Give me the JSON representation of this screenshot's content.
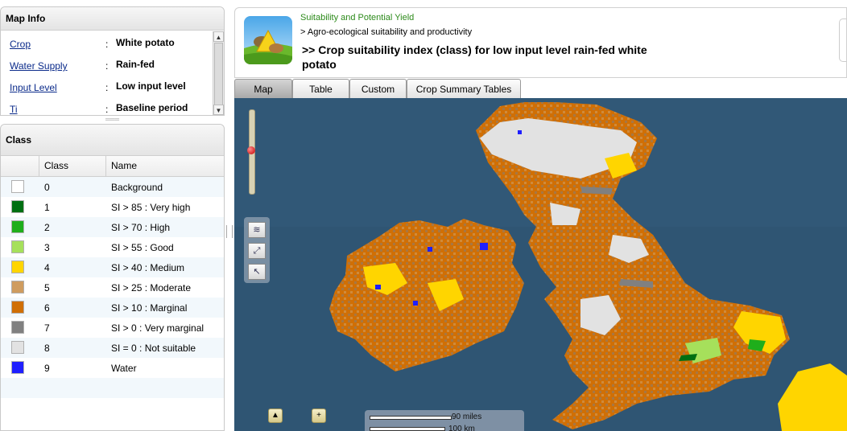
{
  "map_info": {
    "title": "Map Info",
    "rows": [
      {
        "key": "Crop",
        "sep": ":",
        "value": "White potato"
      },
      {
        "key": "Water Supply",
        "sep": ":",
        "value": "Rain-fed"
      },
      {
        "key": "Input Level",
        "sep": ":",
        "value": "Low input level"
      },
      {
        "key": "Ti",
        "sep": ":",
        "value": "Baseline period"
      }
    ]
  },
  "class_panel": {
    "title": "Class",
    "columns": [
      "Class",
      "Name"
    ],
    "rows": [
      {
        "class": "0",
        "name": "Background",
        "color": "#ffffff"
      },
      {
        "class": "1",
        "name": "SI > 85 : Very high",
        "color": "#006f12"
      },
      {
        "class": "2",
        "name": "SI > 70 : High",
        "color": "#1fae1b"
      },
      {
        "class": "3",
        "name": "SI > 55 : Good",
        "color": "#a6e05b"
      },
      {
        "class": "4",
        "name": "SI > 40 : Medium",
        "color": "#ffd500"
      },
      {
        "class": "5",
        "name": "SI > 25 : Moderate",
        "color": "#cf9c5f"
      },
      {
        "class": "6",
        "name": "SI > 10 : Marginal",
        "color": "#d06f05"
      },
      {
        "class": "7",
        "name": "SI >  0 : Very marginal",
        "color": "#808080"
      },
      {
        "class": "8",
        "name": "SI =  0 : Not suitable",
        "color": "#e2e2e2"
      },
      {
        "class": "9",
        "name": "Water",
        "color": "#1f1fff"
      }
    ]
  },
  "header": {
    "crumb1": "Suitability and Potential Yield",
    "crumb2": "> Agro-ecological suitability and productivity",
    "title": ">> Crop suitability index (class) for low input level rain-fed white potato"
  },
  "tabs": [
    {
      "label": "Map",
      "active": true
    },
    {
      "label": "Table",
      "active": false
    },
    {
      "label": "Custom",
      "active": false
    },
    {
      "label": "Crop Summary Tables",
      "active": false
    }
  ],
  "map": {
    "scale_miles": "90 miles",
    "scale_km": "100 km",
    "tools": [
      "layers-icon",
      "zoom-extent-icon",
      "pointer-icon"
    ]
  }
}
